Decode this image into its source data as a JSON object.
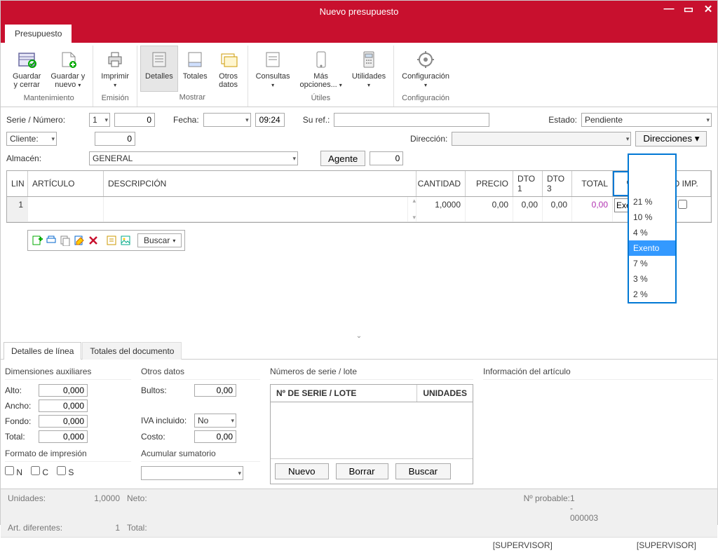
{
  "window": {
    "title": "Nuevo presupuesto"
  },
  "tabs": {
    "main": "Presupuesto"
  },
  "ribbon": {
    "mantenimiento": {
      "label": "Mantenimiento",
      "guardar_cerrar": "Guardar\ny cerrar",
      "guardar_nuevo": "Guardar y\nnuevo"
    },
    "emision": {
      "label": "Emisión",
      "imprimir": "Imprimir"
    },
    "mostrar": {
      "label": "Mostrar",
      "detalles": "Detalles",
      "totales": "Totales",
      "otros_datos": "Otros\ndatos"
    },
    "utiles": {
      "label": "Útiles",
      "consultas": "Consultas",
      "mas_opciones": "Más\nopciones...",
      "utilidades": "Utilidades"
    },
    "config": {
      "label": "Configuración",
      "configuracion": "Configuración"
    }
  },
  "form": {
    "serie_label": "Serie / Número:",
    "serie_val": "1",
    "numero_val": "0",
    "fecha_label": "Fecha:",
    "hora_val": "09:24",
    "suref_label": "Su ref.:",
    "estado_label": "Estado:",
    "estado_val": "Pendiente",
    "cliente_label": "Cliente:",
    "cliente_val": "0",
    "direccion_label": "Dirección:",
    "direcciones_btn": "Direcciones",
    "almacen_label": "Almacén:",
    "almacen_val": "GENERAL",
    "agente_btn": "Agente",
    "agente_val": "0"
  },
  "grid": {
    "cols": {
      "lin": "LIN",
      "articulo": "ARTÍCULO",
      "descripcion": "DESCRIPCIÓN",
      "cantidad": "CANTIDAD",
      "precio": "PRECIO",
      "dto1": "DTO 1",
      "dto3": "DTO 3",
      "total": "TOTAL",
      "iva": "% IVA",
      "noimp": "NO IMP."
    },
    "row": {
      "lin": "1",
      "cantidad": "1,0000",
      "precio": "0,00",
      "dto1": "0,00",
      "dto3": "0,00",
      "total": "0,00",
      "iva_sel": "Exent"
    },
    "buscar": "Buscar"
  },
  "iva_options": [
    "21 %",
    "10 %",
    "4 %",
    "Exento",
    "7 %",
    "3 %",
    "2 %"
  ],
  "iva_highlight": "Exento",
  "bottom_tabs": {
    "a": "Detalles de línea",
    "b": "Totales del documento"
  },
  "details": {
    "dim_title": "Dimensiones auxiliares",
    "alto": "Alto:",
    "ancho": "Ancho:",
    "fondo": "Fondo:",
    "total": "Total:",
    "val_zero": "0,000",
    "formato_title": "Formato de impresión",
    "n": "N",
    "c": "C",
    "s": "S",
    "otros_title": "Otros datos",
    "bultos": "Bultos:",
    "bultos_val": "0,00",
    "iva_incl": "IVA incluido:",
    "iva_incl_val": "No",
    "costo": "Costo:",
    "costo_val": "0,00",
    "acum_title": "Acumular sumatorio",
    "serie_title": "Números de serie / lote",
    "serie_col1": "Nº DE SERIE / LOTE",
    "serie_col2": "UNIDADES",
    "nuevo_btn": "Nuevo",
    "borrar_btn": "Borrar",
    "buscar_btn": "Buscar",
    "info_title": "Información del artículo"
  },
  "footer": {
    "unidades_lbl": "Unidades:",
    "unidades_val": "1,0000",
    "neto_lbl": "Neto:",
    "artdif_lbl": "Art. diferentes:",
    "artdif_val": "1",
    "total_lbl": "Total:",
    "nprob_lbl": "Nº probable:",
    "nprob_val": "1 - 000003"
  },
  "status": {
    "left": "[SUPERVISOR]",
    "right": "[SUPERVISOR]"
  }
}
